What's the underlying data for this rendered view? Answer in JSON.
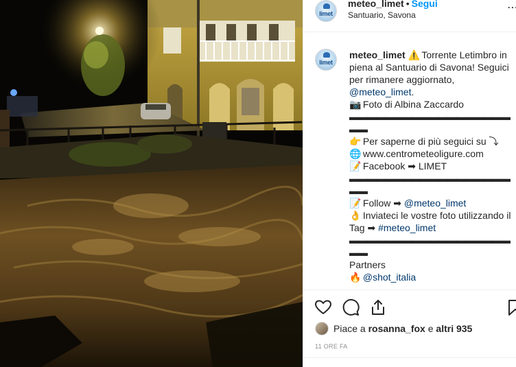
{
  "post": {
    "username": "meteo_limet",
    "separator_dot": "•",
    "follow_label": "Segui",
    "location": "Santuario, Savona",
    "avatar_text": "limet",
    "more_icon": "⋯"
  },
  "caption": {
    "username": "meteo_limet",
    "line1_emoji": "⚠️",
    "line1": "Torrente Letimbro in piena al Santuario di Savona! Seguici per rimanere aggiornato,",
    "line1_mention": "@meteo_limet",
    "line1_end": ".",
    "photo_emoji": "📷",
    "photo_text": "Foto di Albina Zaccardo",
    "separator": "▬▬▬▬▬▬▬▬▬▬▬▬▬▬▬▬▬▬▬▬",
    "more_emoji": "👉",
    "more_text": "Per saperne di più seguici su ⤵",
    "web_emoji": "🌐",
    "web_text": "www.centrometeoligure.com",
    "fb_emoji": "📝",
    "fb_text": "Facebook ➡ LIMET",
    "follow_emoji": "📝",
    "follow_text": "Follow ➡ ",
    "follow_mention": "@meteo_limet",
    "send_emoji": "👌",
    "send_text": "Inviateci le vostre foto utilizzando il Tag ➡ ",
    "send_hashtag": "#meteo_limet",
    "partners_label": "Partners",
    "partners_emoji": "🔥",
    "partners_mention": "@shot_italia"
  },
  "actions": {
    "like_icon": "heart-icon",
    "comment_icon": "comment-icon",
    "share_icon": "share-icon",
    "save_icon": "bookmark-icon"
  },
  "likes": {
    "prefix": "Piace a ",
    "user": "rosanna_fox",
    "middle": " e ",
    "others": "altri 935"
  },
  "timestamp": "11 ORE FA"
}
